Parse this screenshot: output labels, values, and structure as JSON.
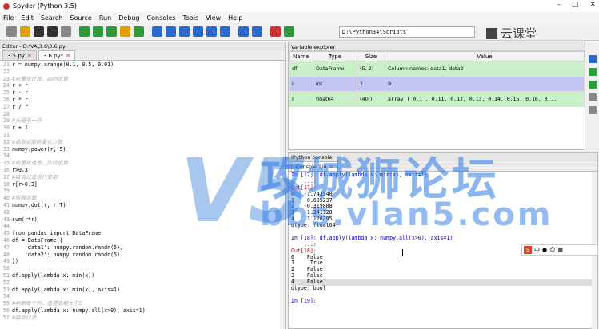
{
  "window": {
    "title": "Spyder (Python 3.5)"
  },
  "menu": [
    "File",
    "Edit",
    "Search",
    "Source",
    "Run",
    "Debug",
    "Consoles",
    "Tools",
    "View",
    "Help"
  ],
  "toolbar": {
    "path": "D:\\Python34\\Scripts"
  },
  "brand_logo": "云课堂",
  "editor": {
    "title": "Editor - D:\\VA\\3.6\\3.6.py",
    "tabs": [
      {
        "label": "3.5.py"
      },
      {
        "label": "3.6.py*"
      }
    ],
    "lines": [
      {
        "n": "21",
        "t": "r = numpy.arange(0.1, 0.5, 0.01)"
      },
      {
        "n": "22",
        "t": ""
      },
      {
        "n": "23",
        "t": "#向量化计算，四则运算"
      },
      {
        "n": "24",
        "t": "r + r"
      },
      {
        "n": "25",
        "t": "r - r"
      },
      {
        "n": "26",
        "t": "r * r"
      },
      {
        "n": "27",
        "t": "r / r"
      },
      {
        "n": "28",
        "t": ""
      },
      {
        "n": "29",
        "t": "#长短不一样"
      },
      {
        "n": "30",
        "t": "r + 1"
      },
      {
        "n": "31",
        "t": ""
      },
      {
        "n": "32",
        "t": "#函数式的向量化计算"
      },
      {
        "n": "33",
        "t": "numpy.power(r, 5)"
      },
      {
        "n": "34",
        "t": ""
      },
      {
        "n": "35",
        "t": "#向量化运算，比较运算"
      },
      {
        "n": "36",
        "t": "r>0.3"
      },
      {
        "n": "37",
        "t": "#结合过滤进行使用"
      },
      {
        "n": "38",
        "t": "r[r>0.3]"
      },
      {
        "n": "39",
        "t": ""
      },
      {
        "n": "40",
        "t": "#矩阵运算"
      },
      {
        "n": "41",
        "t": "numpy.dot(r, r.T)"
      },
      {
        "n": "42",
        "t": ""
      },
      {
        "n": "43",
        "t": "sum(r*r)"
      },
      {
        "n": "44",
        "t": ""
      },
      {
        "n": "45",
        "t": "from pandas import DataFrame"
      },
      {
        "n": "46",
        "t": "df = DataFrame({"
      },
      {
        "n": "47",
        "t": "    'data1': numpy.random.randn(5),"
      },
      {
        "n": "48",
        "t": "    'data2': numpy.random.randn(5)"
      },
      {
        "n": "49",
        "t": "})"
      },
      {
        "n": "50",
        "t": ""
      },
      {
        "n": "51",
        "t": "df.apply(lambda x: min(x))"
      },
      {
        "n": "52",
        "t": ""
      },
      {
        "n": "53",
        "t": "df.apply(lambda x: min(x), axis=1)"
      },
      {
        "n": "54",
        "t": ""
      },
      {
        "n": "55",
        "t": "#判断每个列，值是否都大于0"
      },
      {
        "n": "56",
        "t": "df.apply(lambda x: numpy.all(x>0), axis=1)"
      },
      {
        "n": "57",
        "t": "#结合过滤"
      }
    ]
  },
  "variable_explorer": {
    "title": "Variable explorer",
    "columns": [
      "Name",
      "Type",
      "Size",
      "Value"
    ],
    "rows": [
      {
        "name": "df",
        "type": "DataFrame",
        "size": "(5, 2)",
        "value": "Column names: data1, data2"
      },
      {
        "name": "i",
        "type": "int",
        "size": "1",
        "value": "9"
      },
      {
        "name": "r",
        "type": "float64",
        "size": "(40,)",
        "value": "array([ 0.1 ,  0.11,  0.12,  0.13,  0.14,  0.15,  0.16,  0..."
      }
    ]
  },
  "console": {
    "title": "IPython console",
    "tab": "Console 1/A",
    "lines": [
      {
        "k": "in",
        "t": "In [17]: df.apply(lambda x: min(x), axis=1)"
      },
      {
        "k": "in",
        "t": "    ...:"
      },
      {
        "k": "out",
        "t": "Out[17]:"
      },
      {
        "k": "p",
        "t": "0   -1.743540"
      },
      {
        "k": "p",
        "t": "1    0.605237"
      },
      {
        "k": "p",
        "t": "2   -0.319808"
      },
      {
        "k": "p",
        "t": "3   -1.341128"
      },
      {
        "k": "p",
        "t": "4    1.126295"
      },
      {
        "k": "p",
        "t": "dtype: float64"
      },
      {
        "k": "p",
        "t": ""
      },
      {
        "k": "in",
        "t": "In [18]: df.apply(lambda x: numpy.all(x>0), axis=1)"
      },
      {
        "k": "in",
        "t": "    ...:"
      },
      {
        "k": "out",
        "t": "Out[18]:"
      },
      {
        "k": "p",
        "t": "0    False"
      },
      {
        "k": "p",
        "t": "1     True"
      },
      {
        "k": "p",
        "t": "2    False"
      },
      {
        "k": "p",
        "t": "3    False"
      },
      {
        "k": "hl",
        "t": "4    False"
      },
      {
        "k": "p",
        "t": "dtype: bool"
      },
      {
        "k": "p",
        "t": ""
      },
      {
        "k": "in",
        "t": "In [19]:"
      }
    ]
  },
  "watermark": {
    "big_letter": "V5",
    "text": "攻城狮论坛",
    "url": "bbs.vlan5.com"
  },
  "ime_label": "中"
}
